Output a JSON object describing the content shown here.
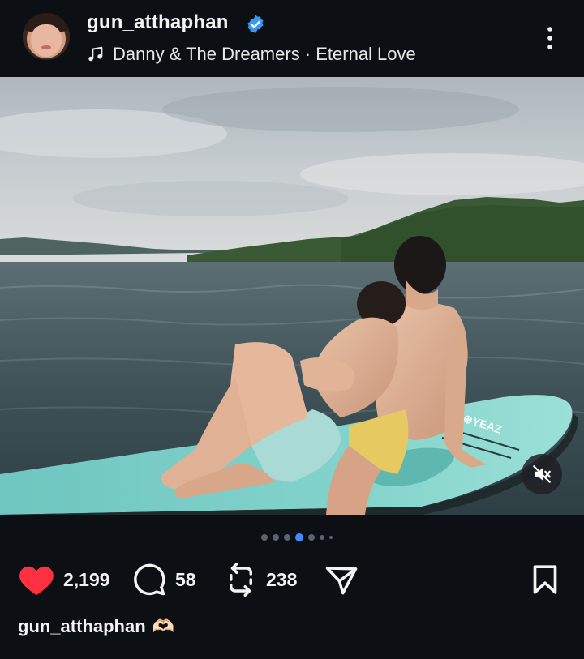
{
  "post": {
    "username": "gun_atthaphan",
    "verified": true,
    "music": "Danny & The Dreamers · Eternal Love",
    "carousel": {
      "total": 7,
      "active_index": 3
    },
    "actions": {
      "likes": "2,199",
      "comments": "58",
      "reposts": "238"
    },
    "caption_user": "gun_atthaphan",
    "caption_emoji": "🫶🏻"
  },
  "icons": {
    "verified": "verified-badge-icon",
    "music": "music-note-icon",
    "more": "more-vertical-icon",
    "mute": "speaker-muted-icon",
    "like": "heart-filled-icon",
    "comment": "comment-bubble-icon",
    "repost": "repost-icon",
    "share": "send-icon",
    "save": "bookmark-icon"
  },
  "colors": {
    "background": "#0c0f14",
    "like": "#ff3040",
    "verified": "#3897f0",
    "active_dot": "#3d8bfd"
  }
}
